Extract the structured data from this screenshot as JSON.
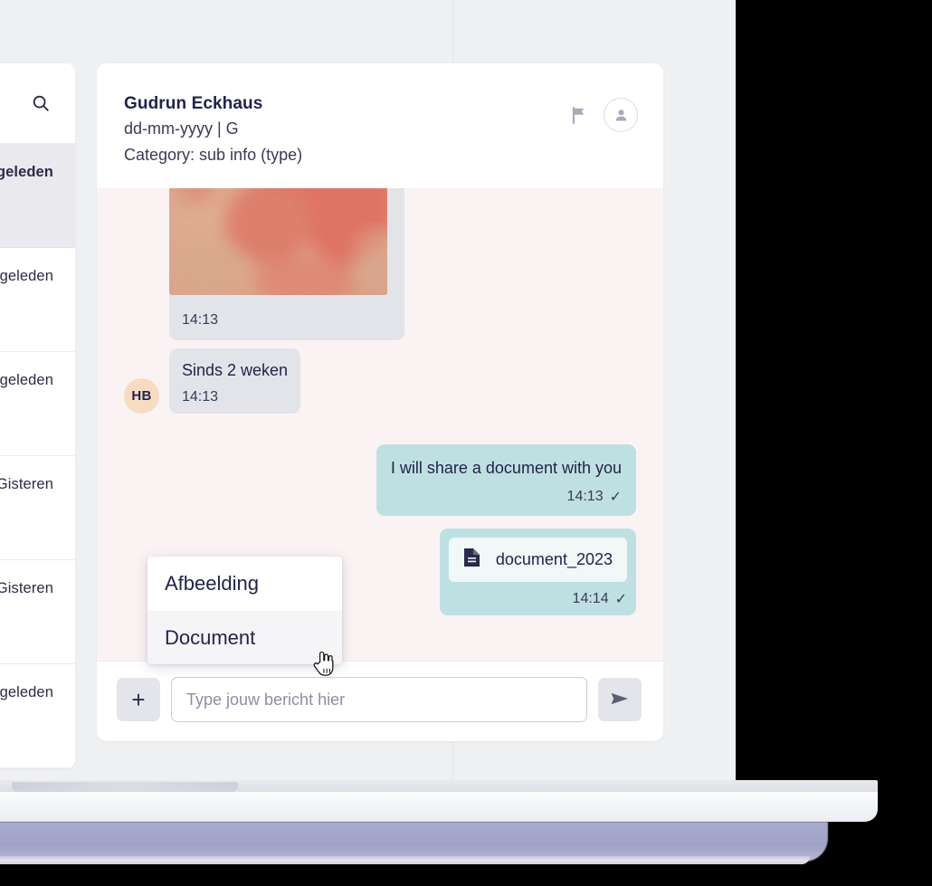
{
  "app": {
    "background_color": "#eff0f2",
    "chat_background_color": "#fbf3f3",
    "accent_outgoing_color": "#bfe0e2",
    "incoming_bubble_color": "#e3e4e9",
    "avatar_color": "#f7dcc2",
    "text_color": "#23234a"
  },
  "sidebar": {
    "search_icon": "search-icon",
    "conversations": [
      {
        "time": "geleden",
        "selected": true
      },
      {
        "time": "geleden",
        "selected": false
      },
      {
        "time": "geleden",
        "selected": false
      },
      {
        "time": "Gisteren",
        "selected": false
      },
      {
        "time": "Gisteren",
        "selected": false
      },
      {
        "time": "geleden",
        "selected": false
      }
    ]
  },
  "chat": {
    "header": {
      "title": "Gudrun Eckhaus",
      "subline_1": "dd-mm-yyyy | G",
      "subline_2": "Category: sub info (type)",
      "flag_icon": "flag-icon",
      "profile_icon": "person-icon"
    },
    "messages": [
      {
        "id": "m1",
        "direction": "in",
        "type": "image",
        "time": "14:13",
        "alt": "skin rash photo"
      },
      {
        "id": "m2",
        "direction": "in",
        "type": "text",
        "text": "Sinds 2 weken",
        "time": "14:13",
        "avatar_initials": "HB"
      },
      {
        "id": "m3",
        "direction": "out",
        "type": "text",
        "text": "I will share a document with you",
        "time": "14:13",
        "status": "✓"
      },
      {
        "id": "m4",
        "direction": "out",
        "type": "document",
        "document_name": "document_2023",
        "time": "14:14",
        "status": "✓"
      }
    ],
    "composer": {
      "attach_label": "+",
      "input_value": "",
      "input_placeholder": "Type jouw bericht hier",
      "send_icon": "send-icon"
    }
  },
  "attach_menu": {
    "items": [
      {
        "label": "Afbeelding",
        "hovered": false
      },
      {
        "label": "Document",
        "hovered": true
      }
    ]
  },
  "cursor": {
    "type": "pointing-hand-cursor"
  }
}
